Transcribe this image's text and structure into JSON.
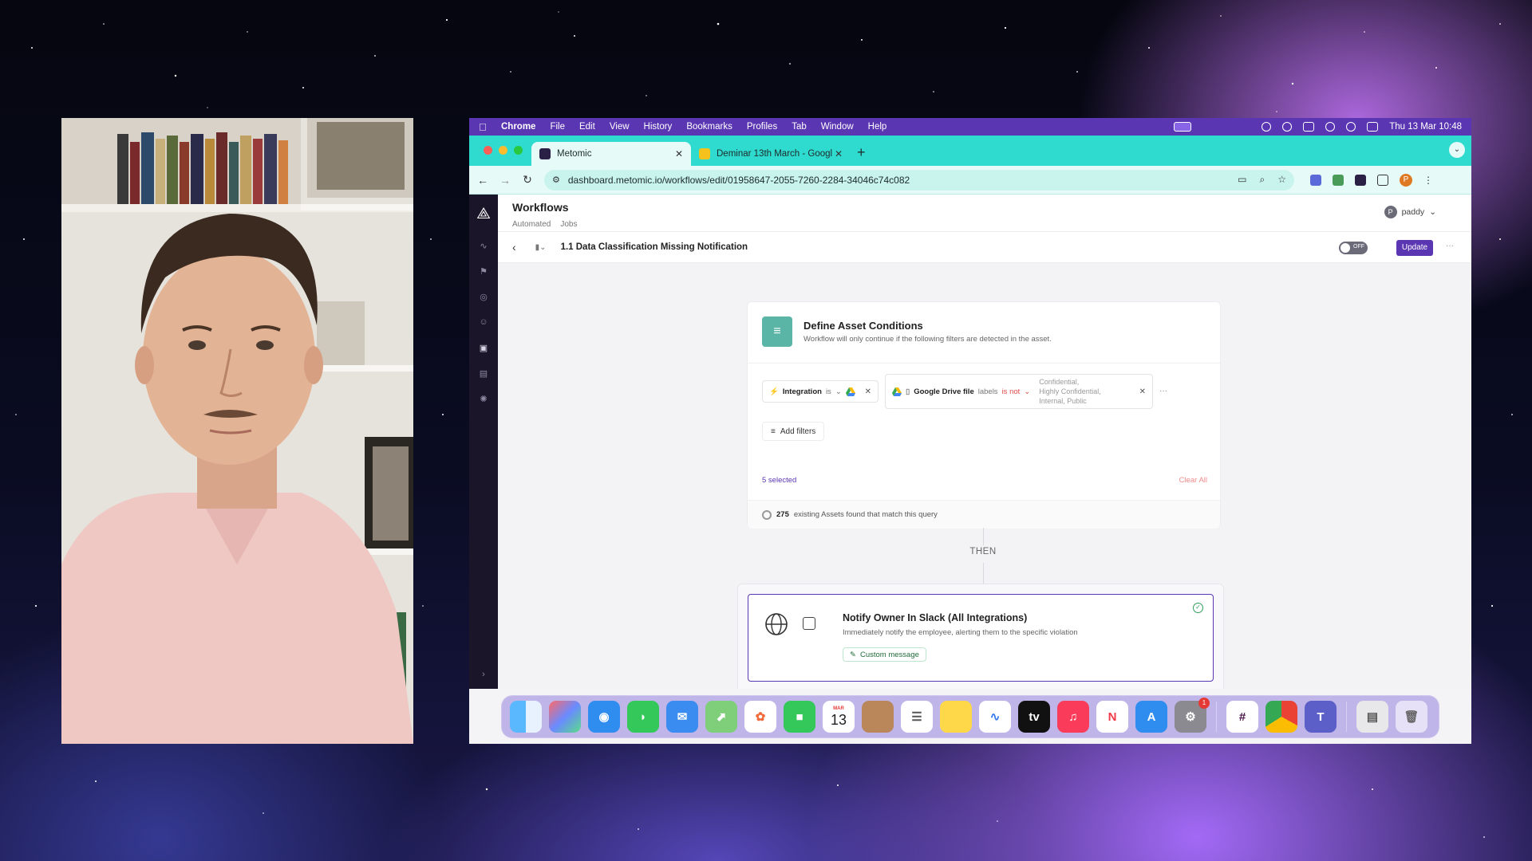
{
  "menubar": {
    "items": [
      "Chrome",
      "File",
      "Edit",
      "View",
      "History",
      "Bookmarks",
      "Profiles",
      "Tab",
      "Window",
      "Help"
    ],
    "clock": "Thu 13 Mar  10:48"
  },
  "browser": {
    "tabs": [
      {
        "title": "Metomic",
        "active": true
      },
      {
        "title": "Deminar 13th March - Googl",
        "active": false
      }
    ],
    "new_tab": "+",
    "url": "dashboard.metomic.io/workflows/edit/01958647-2055-7260-2284-34046c74c082",
    "profile_initial": "P"
  },
  "app": {
    "page_title": "Workflows",
    "subnav": [
      "Automated",
      "Jobs"
    ],
    "user": {
      "initial": "P",
      "name": "paddy"
    },
    "workflow_title": "1.1 Data Classification Missing Notification",
    "toggle_label": "OFF",
    "update_label": "Update",
    "more_label": "···",
    "conditions_card": {
      "title": "Define Asset Conditions",
      "subtitle": "Workflow will only continue if the following filters are detected in the asset.",
      "filter1": {
        "field": "Integration",
        "operator": "is"
      },
      "filter2": {
        "field": "Google Drive file",
        "attr": "labels",
        "operator": "is not",
        "values": [
          "Confidential,",
          "Highly Confidential,",
          "Internal,  Public"
        ]
      },
      "filter_more": "···",
      "add_filters": "Add filters",
      "selected": "5 selected",
      "clear_all": "Clear All",
      "match_count": "275",
      "match_text": "existing Assets found that match this query"
    },
    "then_label": "THEN",
    "action_card": {
      "title": "Notify Owner In Slack (All Integrations)",
      "subtitle": "Immediately notify the employee, alerting them to the specific violation",
      "button": "Custom message"
    }
  },
  "dock": {
    "calendar_month": "MAR",
    "calendar_day": "13",
    "tv_label": "tv",
    "settings_badge": "1"
  },
  "colors": {
    "accent": "#5a36b2",
    "tabbar": "#2fdbcf",
    "danger": "#e24a4a"
  }
}
